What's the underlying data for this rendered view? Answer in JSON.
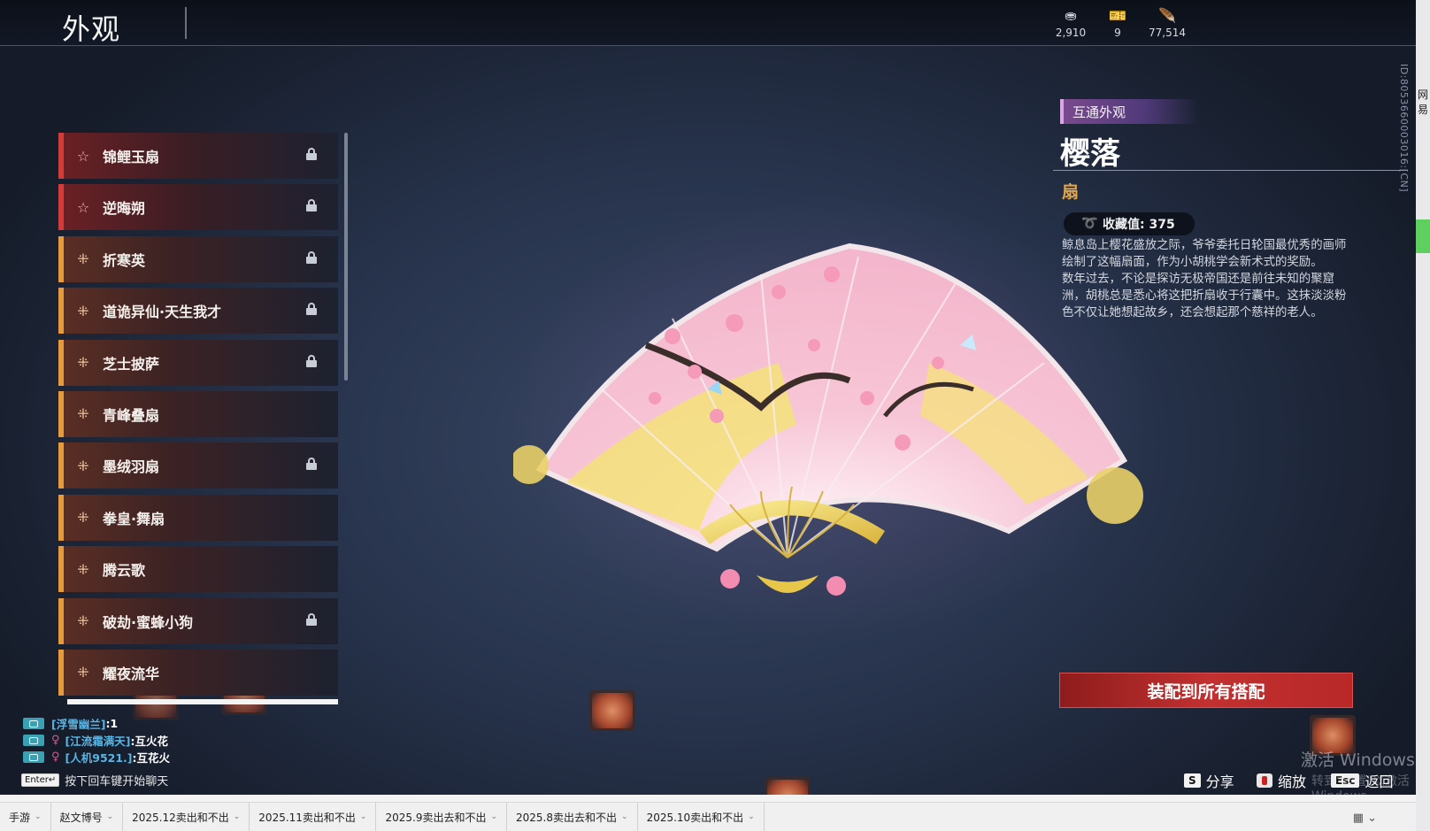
{
  "header": {
    "title": "外观",
    "currencies": [
      {
        "icon": "coin-cluster-icon",
        "value": "2,910"
      },
      {
        "icon": "ticket-icon",
        "value": "9"
      },
      {
        "icon": "feather-icon",
        "value": "77,514"
      }
    ]
  },
  "side_id": "ID:8053660003016:[CN]",
  "edge_label": "网易",
  "list": {
    "items": [
      {
        "label": "锦鲤玉扇",
        "tier": "red",
        "locked": true
      },
      {
        "label": "逆晦朔",
        "tier": "red",
        "locked": true
      },
      {
        "label": "折寒英",
        "tier": "gold",
        "locked": true
      },
      {
        "label": "道诡异仙·天生我才",
        "tier": "gold",
        "locked": true
      },
      {
        "label": "芝士披萨",
        "tier": "gold",
        "locked": true
      },
      {
        "label": "青峰叠扇",
        "tier": "gold",
        "locked": false
      },
      {
        "label": "墨绒羽扇",
        "tier": "gold",
        "locked": true
      },
      {
        "label": "拳皇·舞扇",
        "tier": "gold",
        "locked": false
      },
      {
        "label": "腾云歌",
        "tier": "gold",
        "locked": false
      },
      {
        "label": "破劫·蜜蜂小狗",
        "tier": "gold",
        "locked": true
      },
      {
        "label": "耀夜流华",
        "tier": "gold",
        "locked": false
      }
    ]
  },
  "detail": {
    "tag": "互通外观",
    "name": "樱落",
    "type": "扇",
    "collect_value": "收藏值: 375",
    "description": [
      "鲸息岛上樱花盛放之际，爷爷委托日轮国最优秀的画师绘制了这幅扇面，作为小胡桃学会新术式的奖励。",
      "数年过去，不论是探访无极帝国还是前往未知的聚窟洲，胡桃总是悉心将这把折扇收于行囊中。这抹淡淡粉色不仅让她想起故乡，还会想起那个慈祥的老人。"
    ],
    "equip_button": "装配到所有搭配"
  },
  "chat": {
    "lines": [
      {
        "name": "[浮雪幽兰]",
        "msg": ":1",
        "gender": ""
      },
      {
        "name": "[江流霜满天]",
        "msg": ":互火花",
        "gender": "♀"
      },
      {
        "name": "[人机9521.]",
        "msg": ":互花火",
        "gender": "♀"
      }
    ],
    "enter_key": "Enter↵",
    "hint": "按下回车键开始聊天"
  },
  "hints": {
    "share_key": "S",
    "share_label": "分享",
    "zoom_label": "缩放",
    "back_key": "Esc",
    "back_label": "返回"
  },
  "watermark": {
    "line1": "激活 Windows",
    "line2": "转到\"设置\"以激活 Windows"
  },
  "taskbar": {
    "tabs": [
      "手游",
      "赵文博号",
      "2025.12卖出和不出",
      "2025.11卖出和不出",
      "2025.9卖出去和不出",
      "2025.8卖出去和不出",
      "2025.10卖出和不出"
    ]
  },
  "colors": {
    "accent_red": "#c23030",
    "tier_gold": "#e59a3c",
    "tier_red": "#d63b3b",
    "type_gold": "#e2a64a"
  }
}
